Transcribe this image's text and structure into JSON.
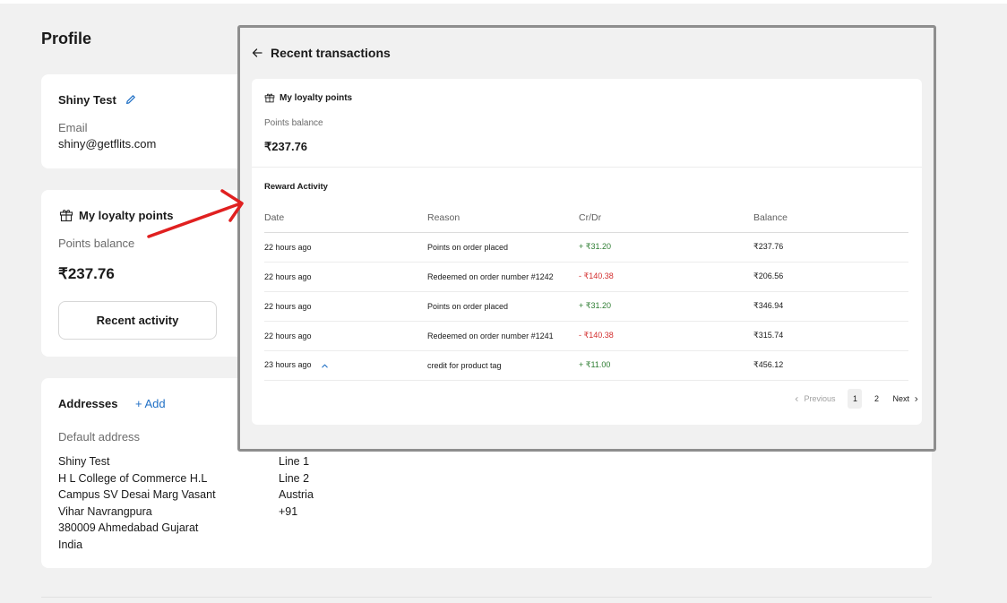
{
  "page": {
    "title": "Profile"
  },
  "user": {
    "name": "Shiny Test",
    "email_label": "Email",
    "email": "shiny@getflits.com"
  },
  "loyalty": {
    "title": "My loyalty points",
    "balance_label": "Points balance",
    "balance": "₹237.76",
    "recent_button": "Recent activity"
  },
  "addresses": {
    "title": "Addresses",
    "add_label": "+ Add",
    "default_label": "Default address",
    "lines_left": [
      "Shiny Test",
      "H L College of Commerce H.L",
      "Campus SV Desai Marg Vasant",
      "Vihar Navrangpura",
      "380009 Ahmedabad Gujarat",
      "India"
    ],
    "lines_right": [
      "Line 1",
      "Line 2",
      "Austria",
      "+91"
    ]
  },
  "modal": {
    "title": "Recent transactions",
    "loyalty_title": "My loyalty points",
    "balance_label": "Points balance",
    "balance": "₹237.76",
    "activity_title": "Reward Activity",
    "columns": [
      "Date",
      "Reason",
      "Cr/Dr",
      "Balance"
    ],
    "rows": [
      {
        "date": "22 hours ago",
        "reason": "Points on order placed",
        "amount": "+ ₹31.20",
        "type": "credit",
        "balance": "₹237.76"
      },
      {
        "date": "22 hours ago",
        "reason": "Redeemed on order number #1242",
        "amount": "- ₹140.38",
        "type": "debit",
        "balance": "₹206.56"
      },
      {
        "date": "22 hours ago",
        "reason": "Points on order placed",
        "amount": "+ ₹31.20",
        "type": "credit",
        "balance": "₹346.94"
      },
      {
        "date": "22 hours ago",
        "reason": "Redeemed on order number #1241",
        "amount": "- ₹140.38",
        "type": "debit",
        "balance": "₹315.74"
      },
      {
        "date": "23 hours ago",
        "reason": "credit for product tag",
        "amount": "+ ₹11.00",
        "type": "credit",
        "balance": "₹456.12"
      }
    ],
    "pagination": {
      "previous": "Previous",
      "pages": [
        "1",
        "2"
      ],
      "current": "1",
      "next": "Next"
    }
  },
  "colors": {
    "credit": "#2e7d32",
    "debit": "#d32f2f",
    "link": "#1f6fc5",
    "annotation_arrow": "#e02020"
  }
}
